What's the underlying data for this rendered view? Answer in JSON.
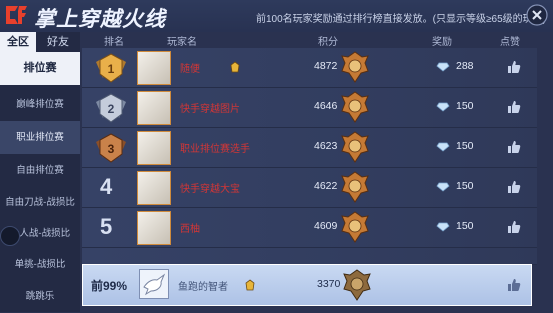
{
  "header": {
    "title": "掌上穿越火线",
    "notice": "前100名玩家奖励通过排行榜直接发放。(只显示等级≥65级的玩家)"
  },
  "tabs": [
    "全区",
    "好友"
  ],
  "sidebar": {
    "items": [
      "排位赛",
      "巅峰排位赛",
      "职业排位赛",
      "自由排位赛",
      "自由刀战-战损比",
      "个人战-战损比",
      "单挑-战损比",
      "跳跳乐"
    ]
  },
  "columns": {
    "rank": "排名",
    "player": "玩家名",
    "score": "积分",
    "reward": "奖励",
    "like": "点赞"
  },
  "rows": [
    {
      "rank": "1",
      "name": "随便",
      "score": "4872",
      "reward": "288"
    },
    {
      "rank": "2",
      "name": "快手穿越图片",
      "score": "4646",
      "reward": "150"
    },
    {
      "rank": "3",
      "name": "职业排位赛选手",
      "score": "4623",
      "reward": "150"
    },
    {
      "rank": "4",
      "name": "快手穿越大宝",
      "score": "4622",
      "reward": "150"
    },
    {
      "rank": "5",
      "name": "西柚",
      "score": "4609",
      "reward": "150"
    }
  ],
  "me": {
    "rank": "前99%",
    "name": "鱼跑的智者",
    "score": "3370"
  },
  "colors": {
    "background": "#2a3250",
    "name_red": "#d23636",
    "highlight": "#c9d9f2",
    "gold": "#d9933b"
  }
}
